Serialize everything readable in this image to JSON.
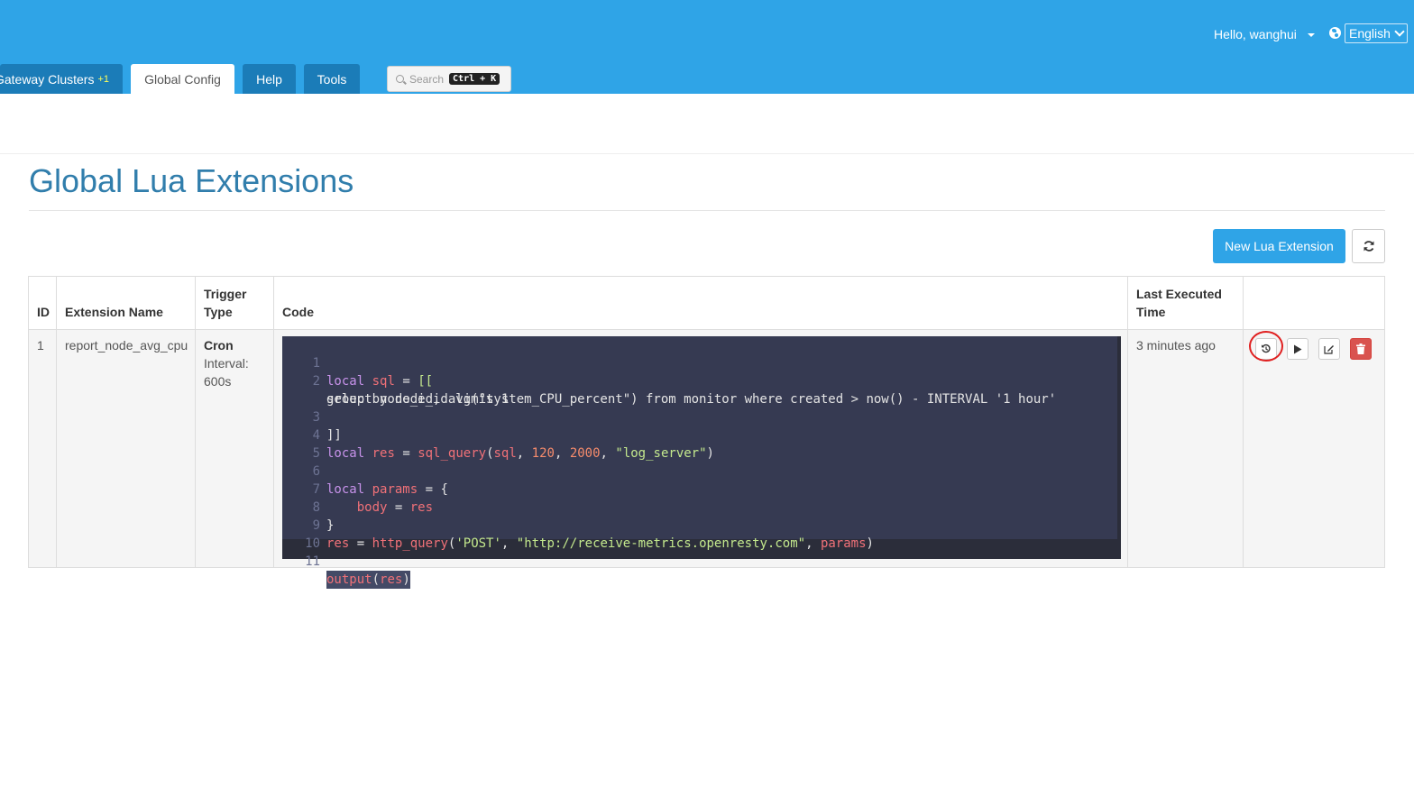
{
  "header": {
    "user_greeting": "Hello, wanghui",
    "language": "English"
  },
  "tabs": [
    {
      "label": "Gateway Clusters",
      "badge": "+1"
    },
    {
      "label": "Global Config"
    },
    {
      "label": "Help"
    },
    {
      "label": "Tools"
    }
  ],
  "search": {
    "placeholder": "Search",
    "shortcut": "Ctrl + K"
  },
  "page": {
    "title": "Global Lua Extensions",
    "new_button": "New Lua Extension"
  },
  "table": {
    "headers": {
      "id": "ID",
      "name": "Extension Name",
      "trigger_1": "Trigger",
      "trigger_2": "Type",
      "code": "Code",
      "last_1": "Last Executed",
      "last_2": "Time"
    },
    "rows": [
      {
        "id": "1",
        "name": "report_node_avg_cpu",
        "trigger_type": "Cron",
        "interval_1": "Interval:",
        "interval_2": "600s",
        "last_executed": "3 minutes ago",
        "code_lines": [
          "local sql = [[",
          "select node_id, avg(\"system_CPU_percent\") from monitor where created > now() - INTERVAL '1 hour'",
          "group by node_id limit 1",
          "]]",
          "local res = sql_query(sql, 120, 2000, \"log_server\")",
          "",
          "local params = {",
          "    body = res",
          "}",
          "res = http_query('POST', \"http://receive-metrics.openresty.com\", params)",
          "",
          "output(res)"
        ]
      }
    ]
  },
  "colors": {
    "brand": "#2fa4e7",
    "tab_inactive": "#1b7cb8",
    "title": "#317eac",
    "code_bg": "#2b2d3a",
    "delete": "#d9534f",
    "highlight_ring": "#e02020"
  }
}
